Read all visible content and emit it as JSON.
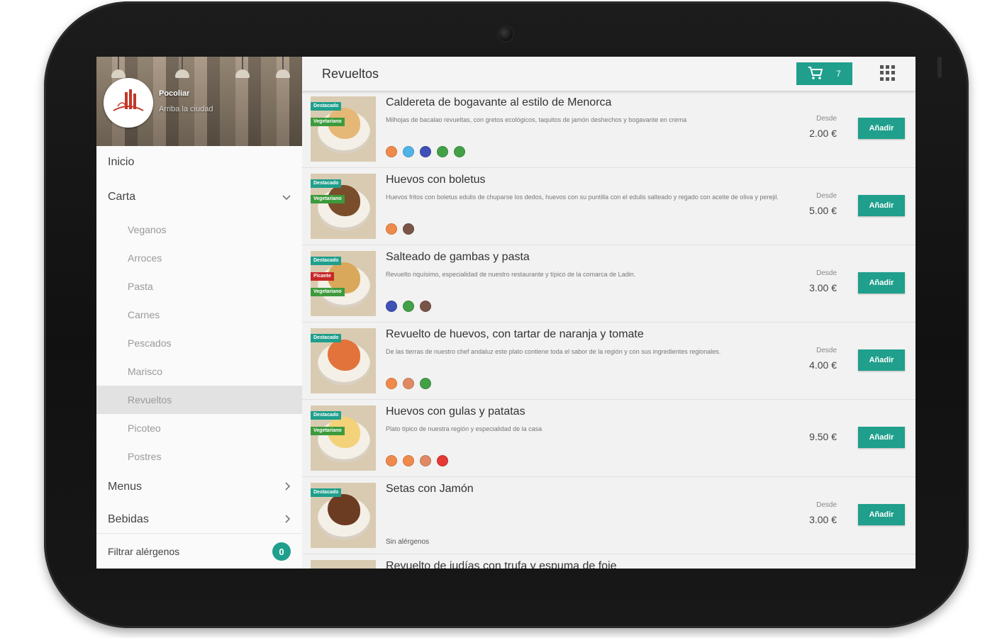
{
  "restaurant": {
    "name": "Pocoliar",
    "subtitle": "Arriba la ciudad"
  },
  "nav": {
    "inicio": "Inicio",
    "carta": "Carta",
    "sub_items": [
      "Veganos",
      "Arroces",
      "Pasta",
      "Carnes",
      "Pescados",
      "Marisco",
      "Revueltos",
      "Picoteo",
      "Postres"
    ],
    "active_sub": "Revueltos",
    "menus": "Menus",
    "bebidas": "Bebidas"
  },
  "filter": {
    "label": "Filtrar alérgenos",
    "count": "0"
  },
  "header": {
    "title": "Revueltos",
    "cart_count": "7"
  },
  "labels": {
    "add": "Añadir",
    "from": "Desde",
    "no_allergens": "Sin alérgenos"
  },
  "icons": {
    "cart": "shopping-cart-icon",
    "apps": "grid-icon",
    "expand": "chevron-down-icon",
    "collapse": "chevron-right-icon"
  },
  "colors": {
    "accent": "#1f9f8c",
    "destacado": "#1f9f8c",
    "vegetariano": "#3c9a3c",
    "picante": "#c62828"
  },
  "items": [
    {
      "name": "Caldereta de bogavante al estilo de Menorca",
      "description": "Milhojas de bacalao revueltas, con gretos ecológicos, taquitos de jamón deshechos y bogavante en crema",
      "from": "Desde",
      "price": "2.00 €",
      "tags": [
        "Destacado",
        "Vegetariano"
      ],
      "allergens": [
        "#f08a4b",
        "#4fb3e8",
        "#3f51b5",
        "#43a047",
        "#43a047"
      ]
    },
    {
      "name": "Huevos con boletus",
      "description": "Huevos fritos con boletus edulis de chuparse los dedos, huevos con su puntilla con el edulis salteado y regado con aceite de oliva y perejil.",
      "from": "Desde",
      "price": "5.00 €",
      "tags": [
        "Destacado",
        "Vegetariano"
      ],
      "allergens": [
        "#f08a4b",
        "#795548"
      ]
    },
    {
      "name": "Salteado de gambas y pasta",
      "description": "Revuelto riquísimo, especialidad de nuestro restaurante y típico de la comarca de Ladin.",
      "from": "Desde",
      "price": "3.00 €",
      "tags": [
        "Destacado",
        "Picante",
        "Vegetariano"
      ],
      "allergens": [
        "#3f51b5",
        "#43a047",
        "#795548"
      ]
    },
    {
      "name": "Revuelto de huevos, con tartar de naranja y tomate",
      "description": "De las tierras de nuestro chef andaluz este plato contiene toda el sabor de la región y con sus ingredientes regionales.",
      "from": "Desde",
      "price": "4.00 €",
      "tags": [
        "Destacado"
      ],
      "allergens": [
        "#f08a4b",
        "#e08a63",
        "#43a047"
      ]
    },
    {
      "name": "Huevos con gulas y patatas",
      "description": "Plato típico de nuestra región y especialidad de la casa",
      "from": "",
      "price": "9.50 €",
      "tags": [
        "Destacado",
        "Vegetariano"
      ],
      "allergens": [
        "#f08a4b",
        "#f08a4b",
        "#e08a63",
        "#e53935"
      ]
    },
    {
      "name": "Setas con Jamón",
      "description": "",
      "from": "Desde",
      "price": "3.00 €",
      "tags": [
        "Destacado"
      ],
      "allergens": []
    },
    {
      "name": "Revuelto de judías con trufa y espuma de foie",
      "description": "",
      "from": "",
      "price": "",
      "tags": [],
      "allergens": []
    }
  ]
}
